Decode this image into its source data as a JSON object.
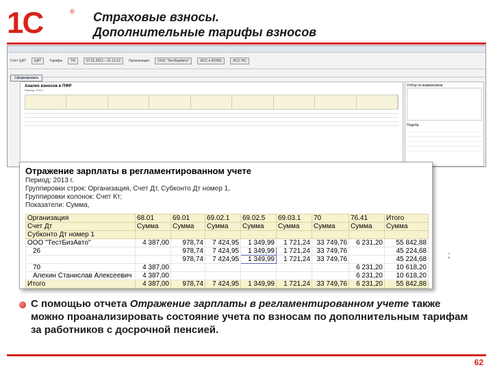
{
  "header": {
    "logo_text": "1С",
    "logo_reg": "®",
    "title_line1": "Страховые взносы.",
    "title_line2": "Дополнительные тарифы взносов"
  },
  "app": {
    "params": [
      "Счёт ЦФТ",
      "ЦФТ",
      "Тарифы",
      "ТФ",
      "07.01.2012 – 31.12.12",
      "Организация",
      "ООО \"ТестБизАвто\"",
      "ФСС и ФОМС",
      "ФСС НС"
    ],
    "generate_button": "Сформировать",
    "report_title": "Анализ взносов в ПФР",
    "report_line": "Период: 2013 г.",
    "side_title": "Отбор по взаимосвязи",
    "side_button": "Подобр"
  },
  "report": {
    "title": "Отражение зарплаты в регламентированном учете",
    "lines": [
      "Период: 2013 г.",
      "Группировки строк: Организация, Счет Дт, Субконто Дт номер 1,",
      "Группировки колонок: Счет Кт;",
      "Показатели: Сумма,"
    ],
    "header_rows": [
      [
        "Организация",
        "68.01",
        "69.01",
        "69.02.1",
        "69.02.5",
        "69.03.1",
        "70",
        "76.41",
        "Итого"
      ],
      [
        "Счет Дт",
        "Сумма",
        "Сумма",
        "Сумма",
        "Сумма",
        "Сумма",
        "Сумма",
        "Сумма",
        "Сумма"
      ],
      [
        "Субконто Дт номер 1",
        "",
        "",
        "",
        "",
        "",
        "",
        "",
        ""
      ]
    ],
    "rows": [
      [
        "ООО \"ТестБизАвто\"",
        "4 387,00",
        "978,74",
        "7 424,95",
        "1 349,99",
        "1 721,24",
        "33 749,76",
        "6 231,20",
        "55 842,88"
      ],
      [
        "26",
        "",
        "978,74",
        "7 424,95",
        "1 349,99",
        "1 721,24",
        "33 749,76",
        "",
        "45 224,68"
      ],
      [
        "",
        "",
        "978,74",
        "7 424,95",
        "1 349,99",
        "1 721,24",
        "33 749,76",
        "",
        "45 224,68"
      ],
      [
        "70",
        "4 387,00",
        "",
        "",
        "",
        "",
        "",
        "6 231,20",
        "10 618,20"
      ],
      [
        "Алехин Станислав Алексеевич",
        "4 387,00",
        "",
        "",
        "",
        "",
        "",
        "6 231,20",
        "10 618,20"
      ]
    ],
    "total_row": [
      "Итого",
      "4 387,00",
      "978,74",
      "7 424,95",
      "1 349,99",
      "1 721,24",
      "33 749,76",
      "6 231,20",
      "55 842,88"
    ]
  },
  "semicolon": ";",
  "description": {
    "part1": "С помощью отчета ",
    "italic": "Отражение зарплаты в регламентированном учете",
    "part2": " также можно проанализировать состояние учета по взносам по дополнительным тарифам за работников с досрочной пенсией."
  },
  "page_number": "62"
}
